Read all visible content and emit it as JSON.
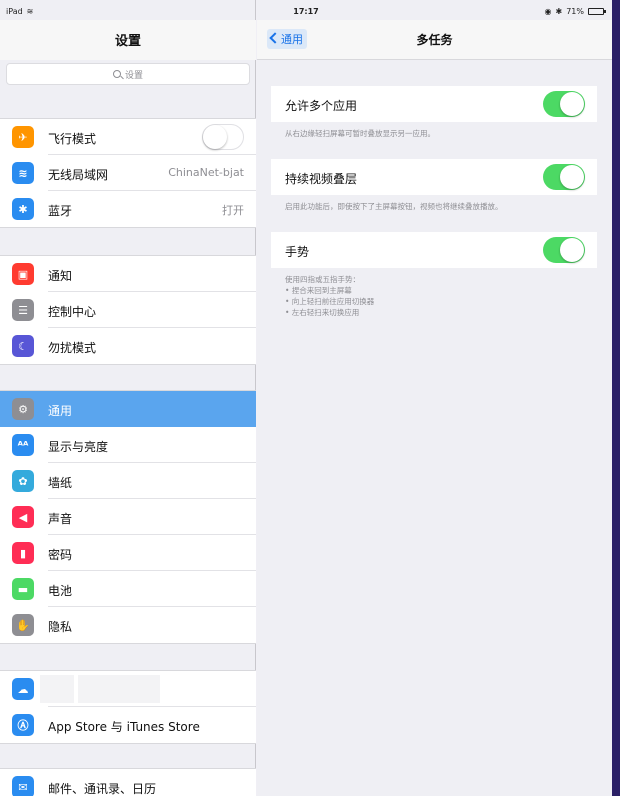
{
  "status_bar": {
    "device": "iPad",
    "time": "17:17",
    "battery": "71%",
    "battery_level": 0.71
  },
  "master": {
    "title": "设置",
    "search_placeholder": "设置",
    "group1": [
      {
        "name": "airplane",
        "icon": "airplane-icon",
        "icon_color": "#ff9500",
        "glyph": "✈",
        "label": "飞行模式",
        "toggle": false
      },
      {
        "name": "wifi",
        "icon": "wifi-icon",
        "icon_color": "#2a8cf0",
        "glyph": "≋",
        "label": "无线局域网",
        "value": "ChinaNet-bjat"
      },
      {
        "name": "bluetooth",
        "icon": "bluetooth-icon",
        "icon_color": "#2a8cf0",
        "glyph": "✱",
        "label": "蓝牙",
        "value": "打开"
      }
    ],
    "group2": [
      {
        "name": "notifications",
        "icon": "notifications-icon",
        "icon_color": "#ff3b30",
        "glyph": "▣",
        "label": "通知"
      },
      {
        "name": "control-center",
        "icon": "control-center-icon",
        "icon_color": "#8e8e93",
        "glyph": "☰",
        "label": "控制中心"
      },
      {
        "name": "do-not-disturb",
        "icon": "moon-icon",
        "icon_color": "#5856d6",
        "glyph": "☾",
        "label": "勿扰模式"
      }
    ],
    "group3": [
      {
        "name": "general",
        "icon": "gear-icon",
        "icon_color": "#8e8e93",
        "glyph": "⚙",
        "label": "通用",
        "selected": true
      },
      {
        "name": "display",
        "icon": "display-icon",
        "icon_color": "#2a8cf0",
        "glyph": "ᴬᴬ",
        "label": "显示与亮度"
      },
      {
        "name": "wallpaper",
        "icon": "wallpaper-icon",
        "icon_color": "#34aadc",
        "glyph": "✿",
        "label": "墙纸"
      },
      {
        "name": "sounds",
        "icon": "speaker-icon",
        "icon_color": "#ff2d55",
        "glyph": "◀",
        "label": "声音"
      },
      {
        "name": "passcode",
        "icon": "lock-icon",
        "icon_color": "#ff2d55",
        "glyph": "▮",
        "label": "密码"
      },
      {
        "name": "battery",
        "icon": "battery-icon",
        "icon_color": "#4cd964",
        "glyph": "▬",
        "label": "电池"
      },
      {
        "name": "privacy",
        "icon": "hand-icon",
        "icon_color": "#8e8e93",
        "glyph": "✋",
        "label": "隐私"
      }
    ],
    "group4": [
      {
        "name": "icloud",
        "icon": "cloud-icon",
        "icon_color": "#2a8cf0",
        "glyph": "☁",
        "label": ""
      },
      {
        "name": "app-store",
        "icon": "app-store-icon",
        "icon_color": "#2a8cf0",
        "glyph": "Ⓐ",
        "label": "App Store 与 iTunes Store"
      }
    ],
    "group5": [
      {
        "name": "mail",
        "icon": "mail-icon",
        "icon_color": "#2a8cf0",
        "glyph": "✉",
        "label": "邮件、通讯录、日历"
      }
    ]
  },
  "detail": {
    "back_label": "通用",
    "title": "多任务",
    "settings": [
      {
        "label": "允许多个应用",
        "on": true,
        "footnote": [
          "从右边缘轻扫屏幕可暂时叠放显示另一应用。"
        ]
      },
      {
        "label": "持续视频叠层",
        "on": true,
        "footnote": [
          "启用此功能后，即使按下了主屏幕按钮，视频也将继续叠放播放。"
        ]
      },
      {
        "label": "手势",
        "on": true,
        "footnote": [
          "使用四指或五指手势：",
          "• 捏合来回到主屏幕",
          "• 向上轻扫前往应用切换器",
          "• 左右轻扫来切换应用"
        ]
      }
    ]
  },
  "colors": {
    "accent": "#1a73e8",
    "selected_row": "#5aa5ee",
    "toggle_on": "#4cd964"
  }
}
